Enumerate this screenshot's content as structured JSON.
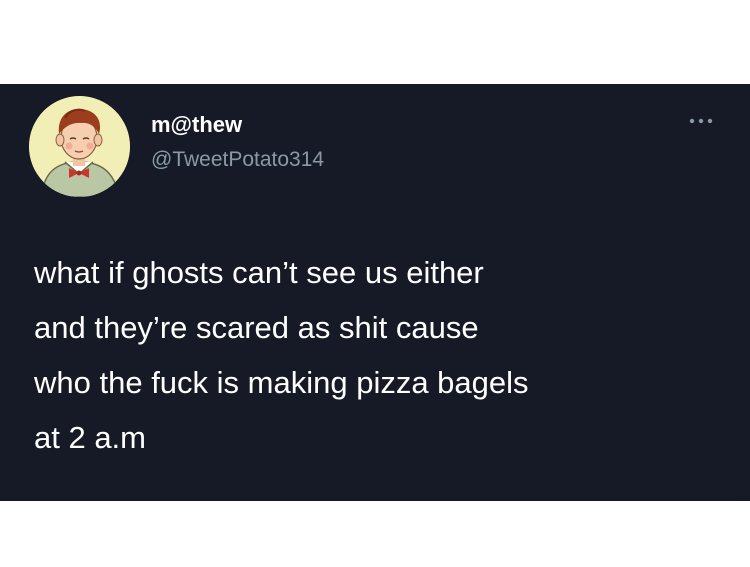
{
  "tweet": {
    "author": {
      "display_name": "m@thew",
      "handle": "@TweetPotato314",
      "avatar_icon": "cartoon-boy-avatar-icon"
    },
    "more_icon": "more-options-icon",
    "text_lines": [
      "what if ghosts can’t see us either",
      "and they’re scared as shit cause",
      "who the fuck is making pizza bagels",
      "at 2 a.m"
    ]
  },
  "colors": {
    "page_background": "#ffffff",
    "card_background": "#161a26",
    "primary_text": "#ffffff",
    "secondary_text": "#8b98a5"
  }
}
